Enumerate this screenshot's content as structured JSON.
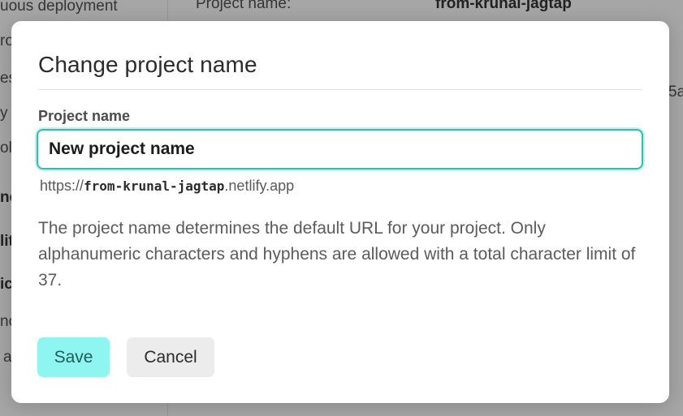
{
  "background": {
    "sidebar_items": [
      "uous deployment",
      "ro",
      "es",
      "y",
      "olu",
      "ne",
      "lit",
      "ic",
      "no",
      "a"
    ],
    "project_name_label": "Project name:",
    "project_name_value": "from-krunal-jagtap",
    "edge_text": "5a"
  },
  "modal": {
    "title": "Change project name",
    "field_label": "Project name",
    "input_value": "",
    "input_placeholder": "New project name",
    "url_prefix": "https://",
    "url_site": "from-krunal-jagtap",
    "url_suffix": ".netlify.app",
    "help_text": "The project name determines the default URL for your project. Only alphanumeric characters and hyphens are allowed with a total character limit of 37.",
    "save_label": "Save",
    "cancel_label": "Cancel"
  },
  "colors": {
    "focus_ring": "#2ac1b5",
    "save_bg": "#8ff5f1",
    "save_text": "#1f5b58",
    "cancel_bg": "#ececec"
  }
}
